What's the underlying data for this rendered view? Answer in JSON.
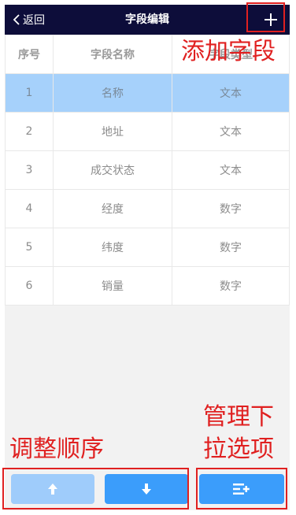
{
  "nav": {
    "back_label": "返回",
    "title": "字段编辑"
  },
  "table": {
    "headers": [
      "序号",
      "字段名称",
      "字段类型"
    ],
    "rows": [
      {
        "index": "1",
        "name": "名称",
        "type": "文本"
      },
      {
        "index": "2",
        "name": "地址",
        "type": "文本"
      },
      {
        "index": "3",
        "name": "成交状态",
        "type": "文本"
      },
      {
        "index": "4",
        "name": "经度",
        "type": "数字"
      },
      {
        "index": "5",
        "name": "纬度",
        "type": "数字"
      },
      {
        "index": "6",
        "name": "销量",
        "type": "数字"
      }
    ],
    "selected_row": 1
  },
  "annotations": {
    "add_field": "添加字段",
    "reorder": "调整顺序",
    "manage_line1": "管理下",
    "manage_line2": "拉选项"
  },
  "colors": {
    "nav_bg": "#0d0d3a",
    "selected_row": "#a6d1fb",
    "primary_button": "#3b9dfb",
    "disabled_button": "#9fccfb",
    "annotation": "#e02020"
  },
  "icons": {
    "back": "chevron-left-icon",
    "add": "plus-icon",
    "up": "arrow-up-icon",
    "down": "arrow-down-icon",
    "manage": "list-add-icon"
  }
}
